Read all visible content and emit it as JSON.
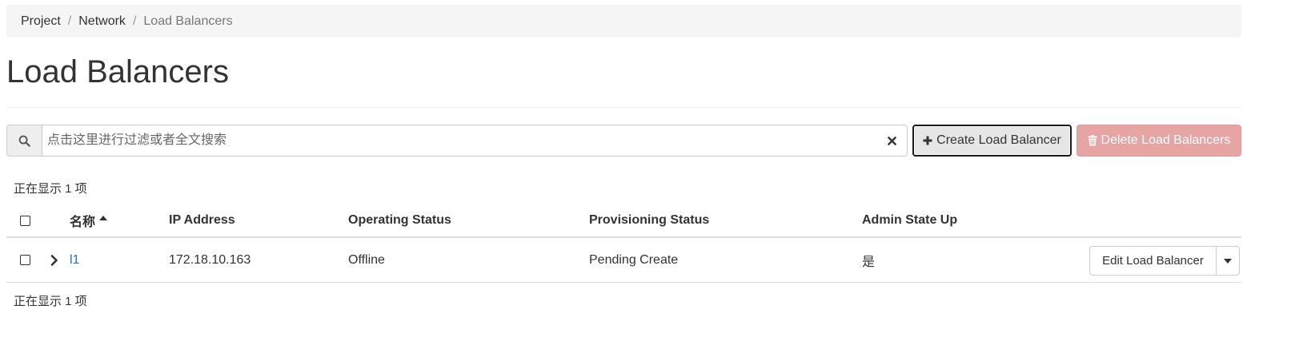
{
  "breadcrumb": {
    "items": [
      "Project",
      "Network"
    ],
    "separator": "/",
    "active": "Load Balancers"
  },
  "page": {
    "title": "Load Balancers"
  },
  "toolbar": {
    "search_placeholder": "点击这里进行过滤或者全文搜索",
    "search_value": "",
    "search_icon": "search-icon",
    "clear_icon": "close-icon",
    "create_label": "Create Load Balancer",
    "create_icon": "plus-icon",
    "delete_label": "Delete Load Balancers",
    "delete_icon": "trash-icon"
  },
  "summary": {
    "top": "正在显示 1 项",
    "bottom": "正在显示 1 项"
  },
  "table": {
    "columns": {
      "name": "名称",
      "ip": "IP Address",
      "operating": "Operating Status",
      "provisioning": "Provisioning Status",
      "admin": "Admin State Up"
    },
    "sort": {
      "column": "名称",
      "direction": "ascending"
    },
    "rows": [
      {
        "name": "l1",
        "ip": "172.18.10.163",
        "operating": "Offline",
        "provisioning": "Pending Create",
        "admin": "是",
        "action_label": "Edit Load Balancer"
      }
    ]
  },
  "colors": {
    "link": "#2a6fb8",
    "danger_disabled": "#e6a5a3",
    "breadcrumb_bg": "#f5f5f5"
  }
}
